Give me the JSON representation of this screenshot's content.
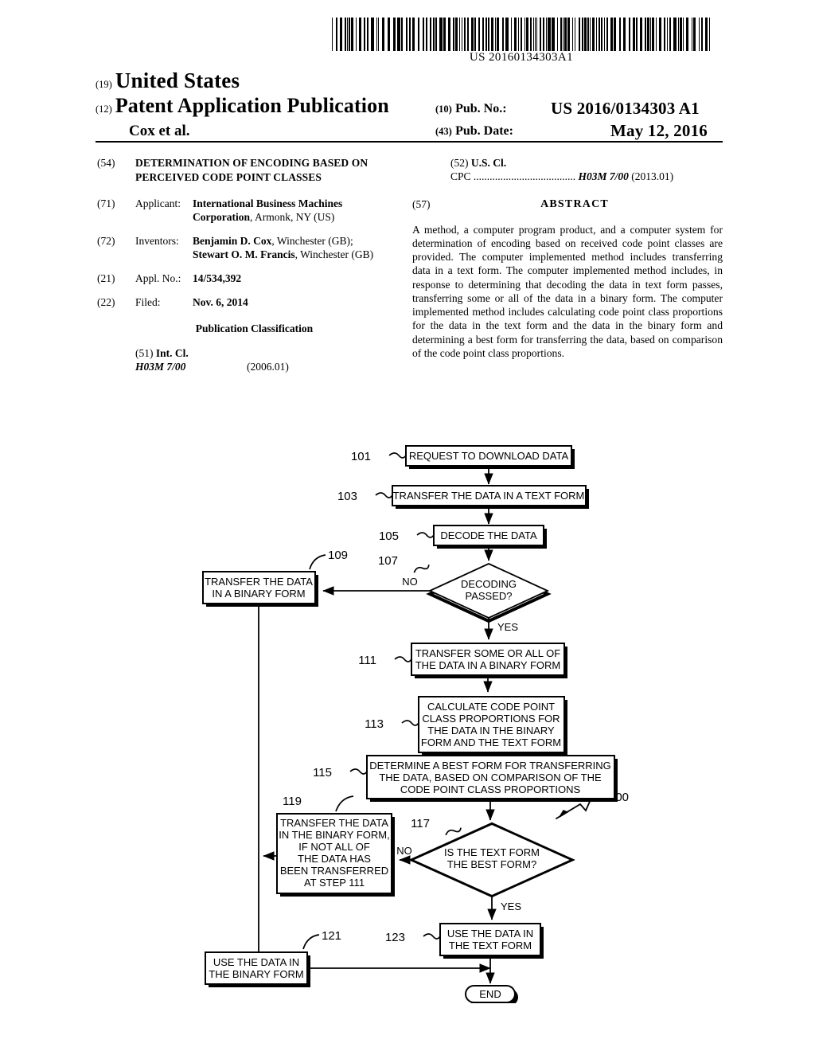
{
  "barcode": {
    "number": "US 20160134303A1"
  },
  "header": {
    "code_19": "(19)",
    "country": "United States",
    "code_12": "(12)",
    "doc_type": "Patent Application Publication",
    "authors": "Cox et al.",
    "code_10": "(10)",
    "pub_no_label": "Pub. No.:",
    "pub_no_value": "US 2016/0134303 A1",
    "code_43": "(43)",
    "pub_date_label": "Pub. Date:",
    "pub_date_value": "May 12, 2016"
  },
  "left_column": {
    "title_code": "(54)",
    "title": "DETERMINATION OF ENCODING BASED ON PERCEIVED CODE POINT CLASSES",
    "applicant_code": "(71)",
    "applicant_label": "Applicant:",
    "applicant_name": "International Business Machines Corporation",
    "applicant_rest": ", Armonk, NY (US)",
    "inventors_code": "(72)",
    "inventors_label": "Inventors:",
    "inventor_1_name": "Benjamin D. Cox",
    "inventor_1_rest": ", Winchester (GB);",
    "inventor_2_name": "Stewart O. M. Francis",
    "inventor_2_rest": ", Winchester",
    "inventor_2_rest2": "(GB)",
    "appl_no_code": "(21)",
    "appl_no_label": "Appl. No.:",
    "appl_no_value": "14/534,392",
    "filed_code": "(22)",
    "filed_label": "Filed:",
    "filed_value": "Nov. 6, 2014",
    "pub_classification": "Publication Classification",
    "int_cl_code": "(51)",
    "int_cl_label": "Int. Cl.",
    "int_cl_value": "H03M 7/00",
    "int_cl_date": "(2006.01)"
  },
  "right_column": {
    "us_cl_code": "(52)",
    "us_cl_label": "U.S. Cl.",
    "cpc_label": "CPC",
    "cpc_dots": "......................................",
    "cpc_value": "H03M 7/00",
    "cpc_date": "(2013.01)",
    "abstract_code": "(57)",
    "abstract_title": "ABSTRACT",
    "abstract_body": "A method, a computer program product, and a computer system for determination of encoding based on received code point classes are provided. The computer implemented method includes transferring data in a text form. The computer implemented method includes, in response to determining that decoding the data in text form passes, transferring some or all of the data in a binary form. The computer implemented method includes calculating code point class proportions for the data in the text form and the data in the binary form and determining a best form for transferring the data, based on comparison of the code point class proportions."
  },
  "flowchart": {
    "diagram_ref": "100",
    "nodes": [
      {
        "ref": "101",
        "text": [
          "REQUEST TO DOWNLOAD DATA"
        ],
        "shape": "process"
      },
      {
        "ref": "103",
        "text": [
          "TRANSFER THE DATA IN A TEXT FORM"
        ],
        "shape": "process"
      },
      {
        "ref": "105",
        "text": [
          "DECODE THE DATA"
        ],
        "shape": "process"
      },
      {
        "ref": "107",
        "text": [
          "DECODING",
          "PASSED?"
        ],
        "shape": "decision"
      },
      {
        "ref": "109",
        "text": [
          "TRANSFER THE DATA",
          "IN A BINARY FORM"
        ],
        "shape": "process"
      },
      {
        "ref": "111",
        "text": [
          "TRANSFER SOME OR ALL OF",
          "THE DATA IN A BINARY FORM"
        ],
        "shape": "process"
      },
      {
        "ref": "113",
        "text": [
          "CALCULATE CODE POINT",
          "CLASS PROPORTIONS FOR",
          "THE DATA IN THE BINARY",
          "FORM AND THE TEXT FORM"
        ],
        "shape": "process"
      },
      {
        "ref": "115",
        "text": [
          "DETERMINE A BEST FORM FOR TRANSFERRING",
          "THE DATA, BASED ON COMPARISON OF THE",
          "CODE POINT CLASS PROPORTIONS"
        ],
        "shape": "process"
      },
      {
        "ref": "117",
        "text": [
          "IS THE TEXT FORM",
          "THE BEST FORM?"
        ],
        "shape": "decision"
      },
      {
        "ref": "119",
        "text": [
          "TRANSFER THE DATA",
          "IN THE BINARY FORM,",
          "IF NOT ALL OF",
          "THE DATA HAS",
          "BEEN TRANSFERRED",
          "AT STEP 111"
        ],
        "shape": "process"
      },
      {
        "ref": "121",
        "text": [
          "USE THE DATA IN",
          "THE BINARY FORM"
        ],
        "shape": "process"
      },
      {
        "ref": "123",
        "text": [
          "USE THE DATA IN",
          "THE TEXT FORM"
        ],
        "shape": "process"
      },
      {
        "ref": "",
        "text": [
          "END"
        ],
        "shape": "terminal"
      }
    ],
    "edge_labels": {
      "no_107": "NO",
      "yes_107": "YES",
      "no_117": "NO",
      "yes_117": "YES"
    }
  }
}
